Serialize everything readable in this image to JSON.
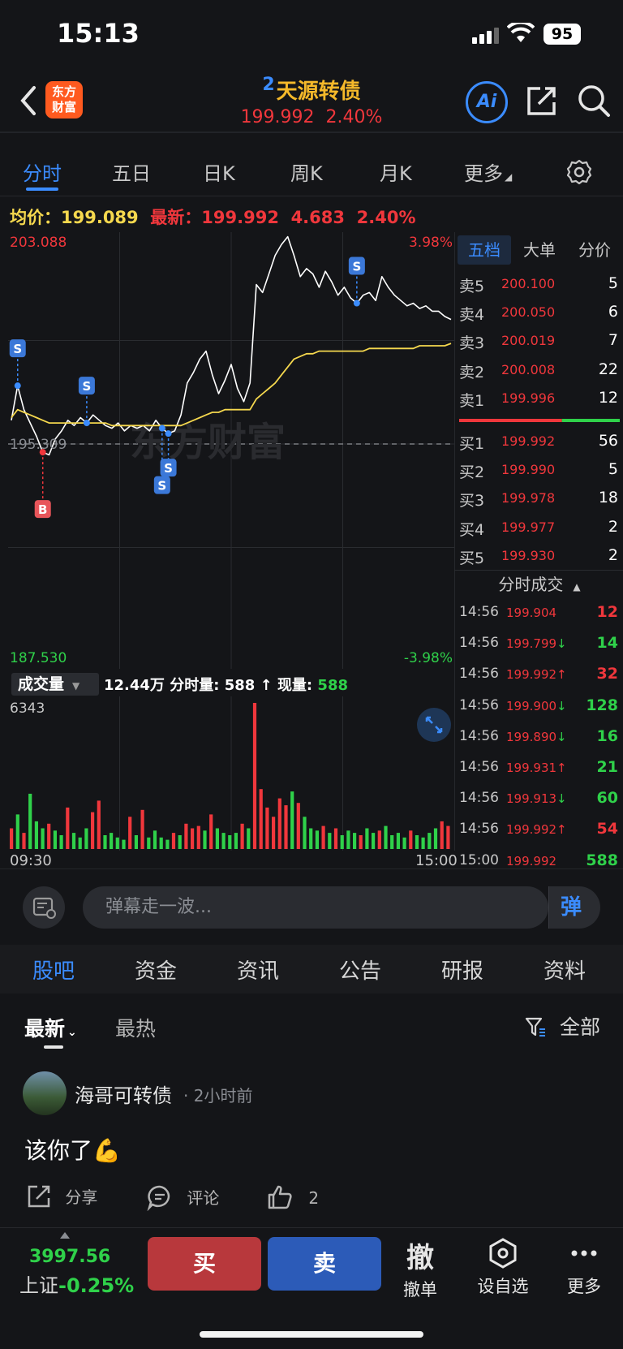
{
  "status_bar": {
    "time": "15:13",
    "battery": "95"
  },
  "header": {
    "logo_line1": "东方",
    "logo_line2": "财富",
    "stock_index": "2",
    "stock_name": "天源转债",
    "price": "199.992",
    "change_pct": "2.40%",
    "ai_label": "Ai"
  },
  "chart_tabs": [
    "分时",
    "五日",
    "日K",
    "周K",
    "月K",
    "更多"
  ],
  "info_line": {
    "avg_label": "均价：",
    "avg_value": "199.089",
    "latest_label": "最新：",
    "latest_value": "199.992",
    "change": "4.683",
    "change_pct": "2.40%"
  },
  "chart_data": {
    "type": "line",
    "x_start": "09:30",
    "x_end": "15:00",
    "y_max": "203.088",
    "y_min": "187.530",
    "y_ref": "195.309",
    "pct_max": "3.98%",
    "pct_min": "-3.98%",
    "ylim": [
      187.53,
      203.088
    ],
    "watermark": "东方财富",
    "series": [
      {
        "name": "price",
        "values": [
          196.2,
          197.5,
          196.6,
          196.1,
          195.6,
          195.0,
          194.9,
          195.5,
          195.8,
          196.2,
          196.0,
          196.3,
          196.1,
          196.4,
          196.2,
          196.0,
          195.9,
          196.1,
          195.8,
          196.0,
          195.9,
          196.0,
          195.8,
          196.2,
          195.9,
          195.7,
          195.8,
          196.4,
          197.6,
          198.0,
          198.5,
          198.8,
          197.9,
          197.2,
          197.7,
          198.3,
          197.4,
          196.9,
          197.6,
          201.3,
          201.0,
          201.7,
          202.4,
          202.8,
          203.1,
          202.4,
          201.6,
          201.9,
          201.7,
          201.2,
          201.8,
          201.4,
          200.9,
          201.2,
          200.8,
          200.6,
          200.9,
          201.0,
          200.7,
          201.6,
          201.2,
          200.9,
          200.7,
          200.5,
          200.6,
          200.4,
          200.5,
          200.3,
          200.3,
          200.1,
          199.99
        ]
      },
      {
        "name": "avg",
        "values": [
          196.3,
          196.6,
          196.5,
          196.4,
          196.3,
          196.2,
          196.1,
          196.1,
          196.1,
          196.1,
          196.1,
          196.1,
          196.1,
          196.1,
          196.1,
          196.1,
          196.0,
          196.0,
          196.0,
          196.0,
          196.0,
          196.0,
          196.0,
          196.0,
          196.0,
          196.0,
          196.0,
          196.0,
          196.1,
          196.2,
          196.3,
          196.4,
          196.5,
          196.5,
          196.6,
          196.6,
          196.6,
          196.6,
          196.6,
          197.0,
          197.2,
          197.4,
          197.6,
          197.9,
          198.2,
          198.5,
          198.6,
          198.7,
          198.7,
          198.8,
          198.8,
          198.8,
          198.8,
          198.8,
          198.8,
          198.8,
          198.8,
          198.9,
          198.9,
          198.9,
          198.9,
          198.9,
          198.9,
          198.9,
          198.9,
          199.0,
          199.0,
          199.0,
          199.0,
          199.0,
          199.089
        ]
      }
    ],
    "markers": [
      "S",
      "B",
      "S",
      "S",
      "S",
      "S"
    ],
    "volume": {
      "ymax_label": "6343",
      "ymax": 6343,
      "values": [
        900,
        1500,
        700,
        2400,
        1200,
        900,
        1100,
        800,
        600,
        1800,
        700,
        500,
        900,
        1600,
        2100,
        600,
        700,
        500,
        400,
        1400,
        600,
        1700,
        500,
        800,
        500,
        400,
        700,
        600,
        1100,
        900,
        1000,
        800,
        1500,
        900,
        700,
        600,
        700,
        1100,
        900,
        6343,
        2600,
        1800,
        1400,
        2200,
        1900,
        2500,
        2000,
        1400,
        900,
        800,
        1000,
        700,
        900,
        600,
        800,
        700,
        600,
        900,
        700,
        800,
        1000,
        600,
        700,
        500,
        800,
        600,
        500,
        700,
        900,
        1200,
        1000
      ],
      "colors": [
        "r",
        "g",
        "r",
        "g",
        "g",
        "g",
        "r",
        "g",
        "g",
        "r",
        "g",
        "g",
        "g",
        "r",
        "r",
        "g",
        "g",
        "g",
        "g",
        "r",
        "g",
        "r",
        "g",
        "g",
        "g",
        "g",
        "r",
        "g",
        "r",
        "r",
        "r",
        "g",
        "r",
        "g",
        "g",
        "g",
        "g",
        "r",
        "g",
        "r",
        "r",
        "r",
        "r",
        "r",
        "r",
        "g",
        "r",
        "g",
        "g",
        "g",
        "r",
        "g",
        "r",
        "g",
        "g",
        "g",
        "r",
        "g",
        "g",
        "r",
        "g",
        "g",
        "g",
        "g",
        "r",
        "g",
        "g",
        "g",
        "g",
        "r",
        "r"
      ]
    }
  },
  "volume_header": {
    "select_label": "成交量",
    "total": "12.44万",
    "minute_label": "分时量:",
    "minute_value": "588",
    "arrow": "↑",
    "current_label": "现量:",
    "current_value": "588"
  },
  "order_book": {
    "tabs": [
      "五档",
      "大单",
      "分价"
    ],
    "asks": [
      {
        "label": "卖5",
        "price": "200.100",
        "qty": "5"
      },
      {
        "label": "卖4",
        "price": "200.050",
        "qty": "6"
      },
      {
        "label": "卖3",
        "price": "200.019",
        "qty": "7"
      },
      {
        "label": "卖2",
        "price": "200.008",
        "qty": "22"
      },
      {
        "label": "卖1",
        "price": "199.996",
        "qty": "12"
      }
    ],
    "bids": [
      {
        "label": "买1",
        "price": "199.992",
        "qty": "56"
      },
      {
        "label": "买2",
        "price": "199.990",
        "qty": "5"
      },
      {
        "label": "买3",
        "price": "199.978",
        "qty": "18"
      },
      {
        "label": "买4",
        "price": "199.977",
        "qty": "2"
      },
      {
        "label": "买5",
        "price": "199.930",
        "qty": "2"
      }
    ],
    "ratio_ask": 0.64
  },
  "trades": {
    "title": "分时成交",
    "rows": [
      {
        "time": "14:56",
        "price": "199.904",
        "dir": "",
        "qty": "12",
        "pcolor": "red",
        "qcolor": "red"
      },
      {
        "time": "14:56",
        "price": "199.799",
        "dir": "↓",
        "qty": "14",
        "pcolor": "red",
        "qcolor": "green"
      },
      {
        "time": "14:56",
        "price": "199.992",
        "dir": "↑",
        "qty": "32",
        "pcolor": "red",
        "qcolor": "red"
      },
      {
        "time": "14:56",
        "price": "199.900",
        "dir": "↓",
        "qty": "128",
        "pcolor": "red",
        "qcolor": "green"
      },
      {
        "time": "14:56",
        "price": "199.890",
        "dir": "↓",
        "qty": "16",
        "pcolor": "red",
        "qcolor": "green"
      },
      {
        "time": "14:56",
        "price": "199.931",
        "dir": "↑",
        "qty": "21",
        "pcolor": "red",
        "qcolor": "green"
      },
      {
        "time": "14:56",
        "price": "199.913",
        "dir": "↓",
        "qty": "60",
        "pcolor": "red",
        "qcolor": "green"
      },
      {
        "time": "14:56",
        "price": "199.992",
        "dir": "↑",
        "qty": "54",
        "pcolor": "red",
        "qcolor": "red"
      },
      {
        "time": "15:00",
        "price": "199.992",
        "dir": "",
        "qty": "588",
        "pcolor": "red",
        "qcolor": "green"
      }
    ]
  },
  "danmu": {
    "placeholder": "弹幕走一波...",
    "send_label": "弹"
  },
  "section_tabs": [
    "股吧",
    "资金",
    "资讯",
    "公告",
    "研报",
    "资料"
  ],
  "sort": {
    "latest": "最新",
    "hot": "最热",
    "filter": "全部"
  },
  "post": {
    "author": "海哥可转债",
    "time": "· 2小时前",
    "body": "该你了💪",
    "share": "分享",
    "comment": "评论",
    "likes": "2"
  },
  "bottom": {
    "index_value": "3997.56",
    "index_name": "上证",
    "index_change": "-0.25%",
    "buy": "买",
    "sell": "卖",
    "cancel_big": "撤",
    "cancel_label": "撤单",
    "watch": "设自选",
    "more": "更多"
  },
  "colors": {
    "accent": "#3b8cff",
    "up": "#f0373c",
    "down": "#2fd14a",
    "avg": "#f5d84e",
    "title": "#f5b92a"
  }
}
